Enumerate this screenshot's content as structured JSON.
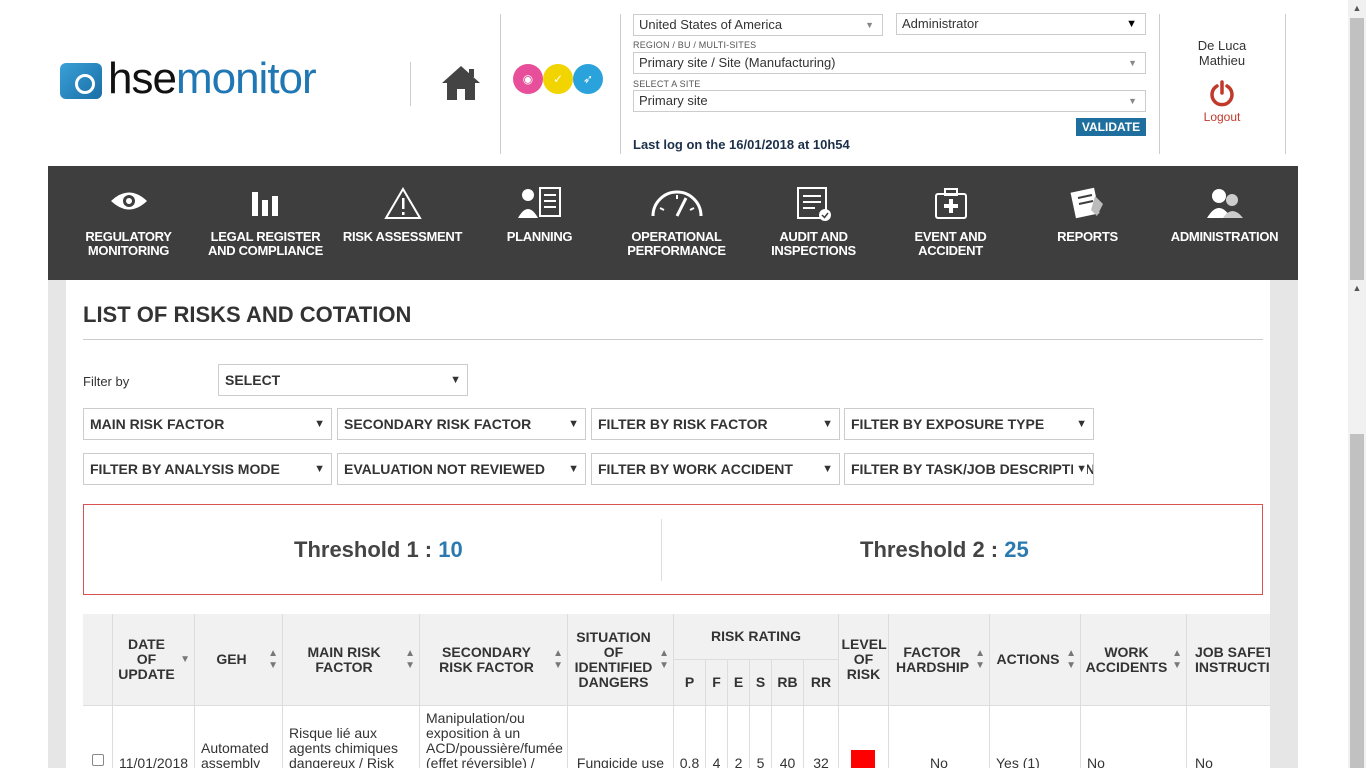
{
  "header": {
    "logo_hse": "hse",
    "logo_monitor": "monitor",
    "country": "United States of America",
    "role": "Administrator",
    "region_label": "REGION / BU / MULTI-SITES",
    "region_value": "Primary site / Site (Manufacturing)",
    "site_label": "SELECT A SITE",
    "site_value": "Primary site",
    "validate_label": "VALIDATE",
    "last_log": "Last log on the 16/01/2018 at 10h54",
    "user_first": "De Luca",
    "user_last": "Mathieu",
    "logout_label": "Logout"
  },
  "nav": [
    {
      "label": "REGULATORY MONITORING",
      "icon": "eye-icon"
    },
    {
      "label": "LEGAL REGISTER AND COMPLIANCE",
      "icon": "bar-chart-icon"
    },
    {
      "label": "RISK ASSESSMENT",
      "icon": "warning-icon"
    },
    {
      "label": "PLANNING",
      "icon": "planning-icon"
    },
    {
      "label": "OPERATIONAL PERFORMANCE",
      "icon": "gauge-icon"
    },
    {
      "label": "AUDIT AND INSPECTIONS",
      "icon": "checklist-icon"
    },
    {
      "label": "EVENT AND ACCIDENT",
      "icon": "first-aid-icon"
    },
    {
      "label": "REPORTS",
      "icon": "report-icon"
    },
    {
      "label": "ADMINISTRATION",
      "icon": "users-icon"
    }
  ],
  "page": {
    "title": "LIST OF RISKS AND COTATION",
    "filter_by_label": "Filter by",
    "filter_by_value": "SELECT"
  },
  "filters": [
    "MAIN RISK FACTOR",
    "SECONDARY RISK FACTOR",
    "FILTER BY RISK FACTOR",
    "FILTER BY EXPOSURE TYPE",
    "FILTER BY ANALYSIS MODE",
    "EVALUATION NOT REVIEWED",
    "FILTER BY WORK ACCIDENT",
    "FILTER BY TASK/JOB DESCRIPTION"
  ],
  "thresholds": {
    "t1_label": "Threshold 1 : ",
    "t1_value": "10",
    "t2_label": "Threshold 2 : ",
    "t2_value": "25"
  },
  "table": {
    "headers": {
      "date": "DATE OF UPDATE",
      "geh": "GEH",
      "main": "MAIN RISK FACTOR",
      "secondary": "SECONDARY RISK FACTOR",
      "situation": "SITUATION OF IDENTIFIED DANGERS",
      "rating": "RISK RATING",
      "p": "P",
      "f": "F",
      "e": "E",
      "s": "S",
      "rb": "RB",
      "rr": "RR",
      "level": "LEVEL OF RISK",
      "hardship": "FACTOR HARDSHIP",
      "actions": "ACTIONS",
      "accidents": "WORK ACCIDENTS",
      "job": "JOB SAFETY INSTRUCTIONS"
    },
    "row": {
      "date": "11/01/2018",
      "geh": "Automated assembly",
      "main": "Risque lié aux agents chimiques dangereux / Risk",
      "secondary": "Manipulation/ou exposition à un ACD/poussière/fumée (effet réversible) /",
      "situation": "Fungicide use",
      "p": "0.8",
      "f": "4",
      "e": "2",
      "s": "5",
      "rb": "40",
      "rr": "32",
      "level_color": "#ff0000",
      "hardship": "No",
      "actions": "Yes (1)",
      "accidents": "No",
      "job": "No"
    }
  }
}
